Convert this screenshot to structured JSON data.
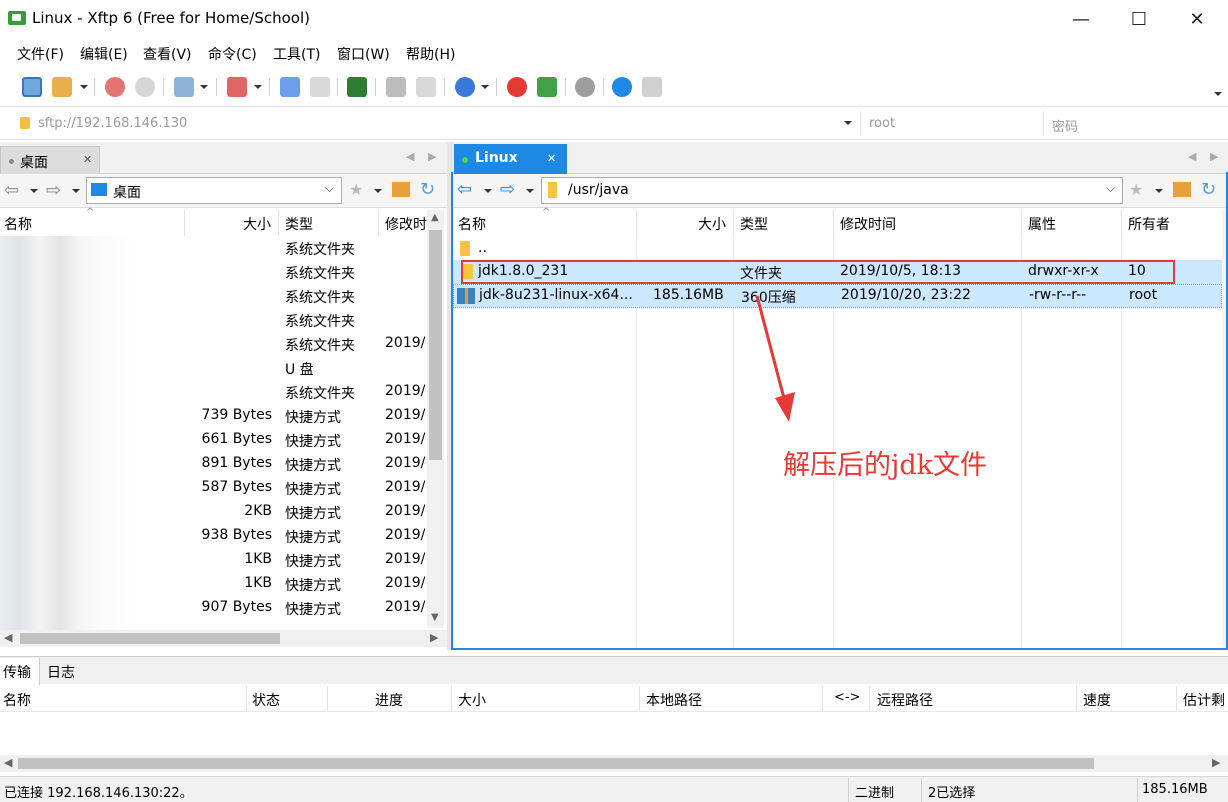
{
  "window": {
    "title": "Linux - Xftp 6 (Free for Home/School)",
    "minimize": "—",
    "maximize": "☐",
    "close": "✕"
  },
  "menu": [
    "文件(F)",
    "编辑(E)",
    "查看(V)",
    "命令(C)",
    "工具(T)",
    "窗口(W)",
    "帮助(H)"
  ],
  "address": {
    "url_placeholder": "sftp://192.168.146.130",
    "user_placeholder": "root",
    "password_placeholder": "密码"
  },
  "left_pane": {
    "tab_label": "桌面",
    "path": "桌面",
    "columns": [
      "名称",
      "大小",
      "类型",
      "修改时"
    ],
    "rows": [
      {
        "size": "",
        "type": "系统文件夹",
        "modified": ""
      },
      {
        "size": "",
        "type": "系统文件夹",
        "modified": ""
      },
      {
        "size": "",
        "type": "系统文件夹",
        "modified": ""
      },
      {
        "size": "",
        "type": "系统文件夹",
        "modified": ""
      },
      {
        "size": "",
        "type": "系统文件夹",
        "modified": "2019/"
      },
      {
        "size": "",
        "type": "U 盘",
        "modified": ""
      },
      {
        "size": "",
        "type": "系统文件夹",
        "modified": "2019/"
      },
      {
        "size": "739 Bytes",
        "type": "快捷方式",
        "modified": "2019/"
      },
      {
        "size": "661 Bytes",
        "type": "快捷方式",
        "modified": "2019/"
      },
      {
        "size": "891 Bytes",
        "type": "快捷方式",
        "modified": "2019/"
      },
      {
        "size": "587 Bytes",
        "type": "快捷方式",
        "modified": "2019/"
      },
      {
        "size": "2KB",
        "type": "快捷方式",
        "modified": "2019/"
      },
      {
        "size": "938 Bytes",
        "type": "快捷方式",
        "modified": "2019/"
      },
      {
        "size": "1KB",
        "type": "快捷方式",
        "modified": "2019/"
      },
      {
        "size": "1KB",
        "type": "快捷方式",
        "modified": "2019/"
      },
      {
        "size": "907 Bytes",
        "type": "快捷方式",
        "modified": "2019/"
      }
    ]
  },
  "right_pane": {
    "tab_label": "Linux",
    "path": "/usr/java",
    "columns": [
      "名称",
      "大小",
      "类型",
      "修改时间",
      "属性",
      "所有者"
    ],
    "rows": [
      {
        "name": "..",
        "size": "",
        "type": "",
        "modified": "",
        "attrs": "",
        "owner": ""
      },
      {
        "name": "jdk1.8.0_231",
        "size": "",
        "type": "文件夹",
        "modified": "2019/10/5, 18:13",
        "attrs": "drwxr-xr-x",
        "owner": "10"
      },
      {
        "name": "jdk-8u231-linux-x64...",
        "size": "185.16MB",
        "type": "360压缩",
        "modified": "2019/10/20, 23:22",
        "attrs": "-rw-r--r--",
        "owner": "root"
      }
    ]
  },
  "annotation": "解压后的jdk文件",
  "bottom": {
    "tabs": [
      "传输",
      "日志"
    ],
    "columns": [
      "名称",
      "状态",
      "进度",
      "大小",
      "本地路径",
      "<->",
      "远程路径",
      "速度",
      "估计剩"
    ]
  },
  "status": {
    "connection": "已连接 192.168.146.130:22。",
    "mode": "二进制",
    "selection": "2已选择",
    "size": "185.16MB"
  },
  "colors": {
    "accent_tab": "#1e88e5",
    "selection": "#cce8ff",
    "annotation_red": "#e53935"
  }
}
